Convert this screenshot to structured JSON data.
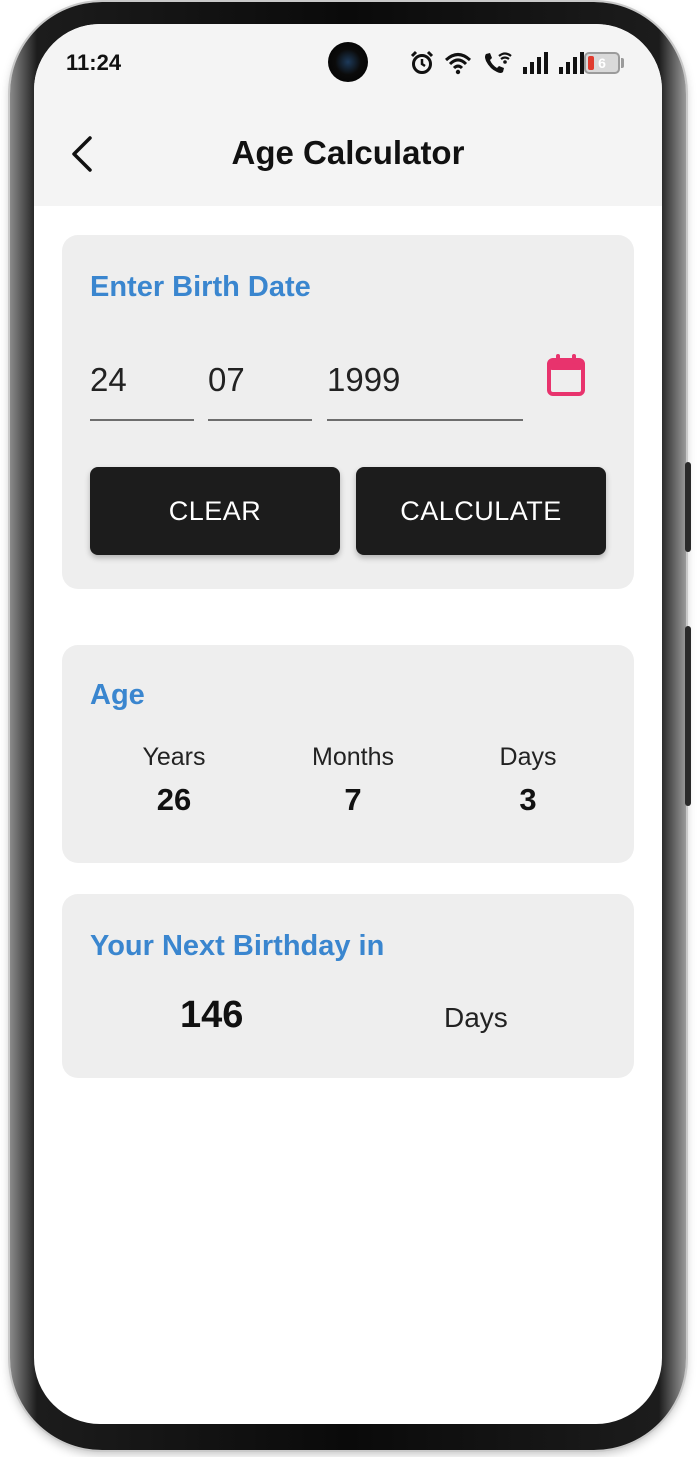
{
  "status_bar": {
    "time": "11:24",
    "battery_level": "6",
    "icons": [
      "alarm-icon",
      "wifi-icon",
      "wifi-calling-icon",
      "signal-icon",
      "signal-icon",
      "battery-icon"
    ]
  },
  "app_bar": {
    "title": "Age Calculator",
    "back_icon": "chevron-left-icon"
  },
  "birth_date_card": {
    "title": "Enter Birth Date",
    "day": "24",
    "month": "07",
    "year": "1999",
    "calendar_icon": "calendar-icon",
    "clear_label": "CLEAR",
    "calculate_label": "CALCULATE"
  },
  "age_card": {
    "title": "Age",
    "columns": [
      {
        "label": "Years",
        "value": "26"
      },
      {
        "label": "Months",
        "value": "7"
      },
      {
        "label": "Days",
        "value": "3"
      }
    ]
  },
  "next_birthday_card": {
    "title": "Your Next Birthday in",
    "value": "146",
    "unit": "Days"
  },
  "colors": {
    "accent": "#3a86cf",
    "calendar_icon": "#e8336d",
    "button_bg": "#1c1c1c",
    "card_bg": "#eeeeee"
  }
}
